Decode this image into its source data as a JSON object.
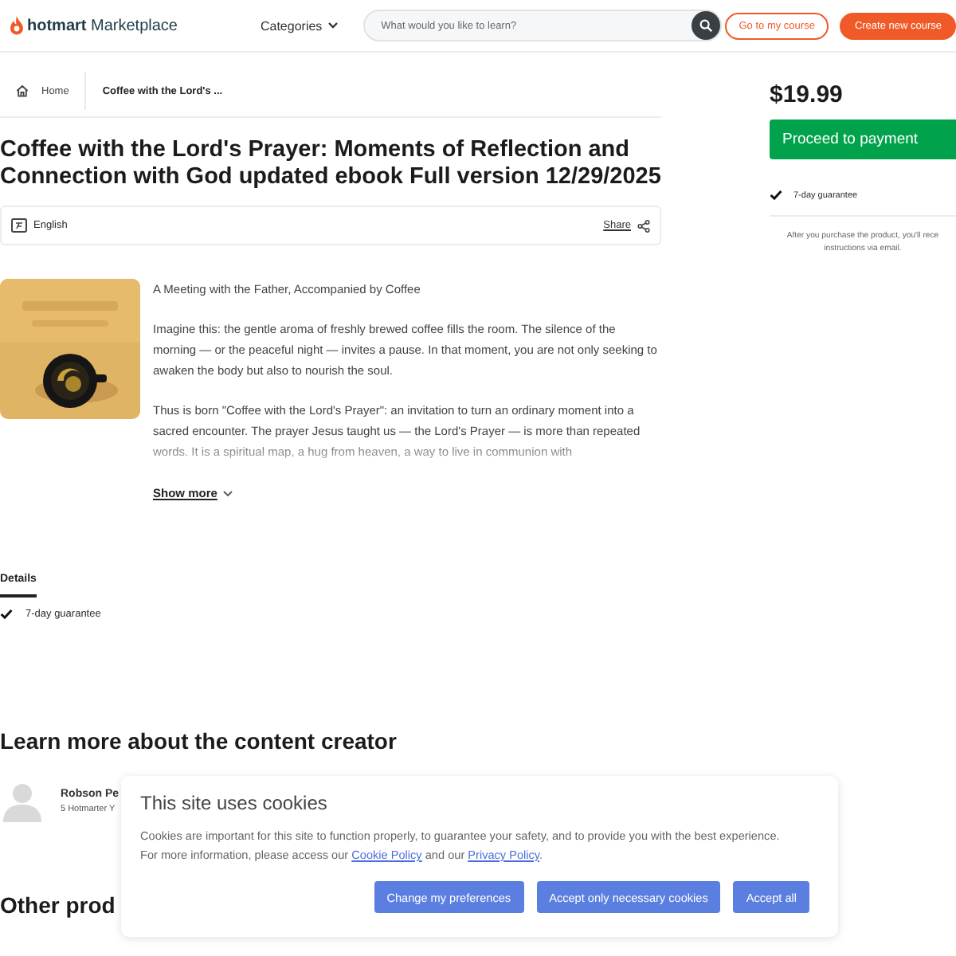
{
  "header": {
    "logo_bold": "hotmart",
    "logo_light": "Marketplace",
    "categories": "Categories",
    "search": {
      "placeholder": "What would you like to learn?"
    },
    "buttons": [
      {
        "label": "Go to my course",
        "kind": "outline"
      },
      {
        "label": "Create new course",
        "kind": "filled"
      }
    ]
  },
  "breadcrumb": [
    {
      "label": "Home",
      "kind": "home"
    },
    {
      "label": "Coffee with the Lord's ...",
      "kind": "current"
    }
  ],
  "product": {
    "title": "Coffee with the Lord's Prayer: Moments of Reflection and Connection with God updated ebook Full version 12/29/2025",
    "language": "English",
    "share": "Share",
    "description": [
      "A Meeting with the Father, Accompanied by Coffee",
      "Imagine this: the gentle aroma of freshly brewed coffee fills the room. The silence of the morning — or the peaceful night — invites a pause. In that moment, you are not only seeking to awaken the body but also to nourish the soul.",
      "Thus is born \"Coffee with the Lord's Prayer\": an invitation to turn an ordinary moment into a sacred encounter. The prayer Jesus taught us — the Lord's Prayer — is more than repeated words. It is a spiritual map, a hug from heaven, a way to live in communion with"
    ],
    "show_more": "Show more"
  },
  "tabs": [
    {
      "label": "Details",
      "selected": true
    }
  ],
  "details": [
    "7-day guarantee"
  ],
  "creator": {
    "heading": "Learn more about the content creator",
    "name": "Robson Pe",
    "meta": "5 Hotmarter Y"
  },
  "other_heading": "Other prod",
  "sidebar": {
    "price": "$19.99",
    "button": "Proceed to payment",
    "guarantee": "7-day guarantee",
    "note": [
      "After you purchase the product, you'll rece",
      "instructions via email."
    ]
  },
  "cookies": {
    "title": "This site uses cookies",
    "body": [
      {
        "kind": "text",
        "text": "Cookies are important for this site to function properly, to guarantee your safety, and to provide you with the best experience. For more information, please access our "
      },
      {
        "kind": "link",
        "text": "Cookie Policy"
      },
      {
        "kind": "text",
        "text": " and our "
      },
      {
        "kind": "link",
        "text": "Privacy Policy"
      },
      {
        "kind": "text",
        "text": "."
      }
    ],
    "buttons": [
      "Change my preferences",
      "Accept only necessary cookies",
      "Accept all"
    ]
  }
}
